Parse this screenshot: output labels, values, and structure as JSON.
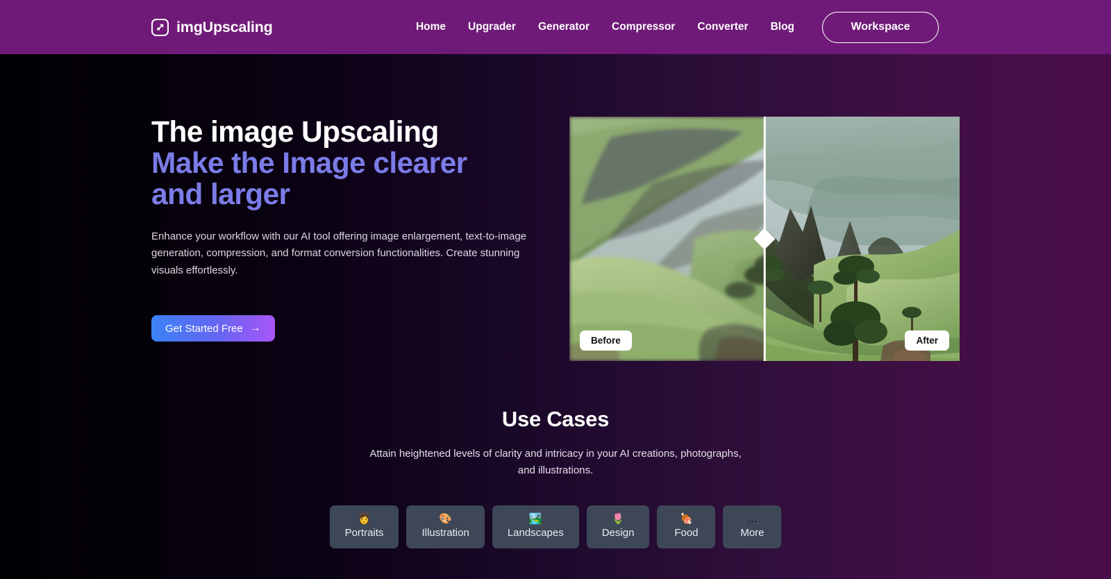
{
  "header": {
    "logo_icon": "expand-arrow-square-icon",
    "brand_name": "imgUpscaling",
    "nav": [
      {
        "label": "Home"
      },
      {
        "label": "Upgrader"
      },
      {
        "label": "Generator"
      },
      {
        "label": "Compressor"
      },
      {
        "label": "Converter"
      },
      {
        "label": "Blog"
      }
    ],
    "workspace_label": "Workspace",
    "background_color": "#6f1a78"
  },
  "hero": {
    "title_line1": "The image Upscaling",
    "title_line2": "Make the Image clearer",
    "title_line3": "and larger",
    "accent_color": "#7b7ce8",
    "paragraph": "Enhance your workflow with our AI tool offering image enlargement, text-to-image generation, compression, and format conversion functionalities. Create stunning visuals effortlessly.",
    "cta_label": "Get Started Free",
    "cta_arrow": "→",
    "cta_gradient_from": "#3b82f6",
    "cta_gradient_to": "#a855f7"
  },
  "comparison": {
    "before_label": "Before",
    "after_label": "After",
    "slider_position_percent": 50,
    "handle_icon": "diamond-slider-handle-icon",
    "subject": "green mountain hillside landscape"
  },
  "usecases": {
    "title": "Use Cases",
    "subtitle": "Attain heightened levels of clarity and intricacy in your AI creations, photographs, and illustrations.",
    "chips": [
      {
        "emoji": "👩",
        "icon": "person-icon",
        "label": "Portraits"
      },
      {
        "emoji": "🎨",
        "icon": "palette-icon",
        "label": "Illustration"
      },
      {
        "emoji": "🏞️",
        "icon": "national-park-icon",
        "label": "Landscapes"
      },
      {
        "emoji": "🌷",
        "icon": "tulip-icon",
        "label": "Design"
      },
      {
        "emoji": "🍖",
        "icon": "meat-on-bone-icon",
        "label": "Food"
      },
      {
        "emoji": "…",
        "icon": "ellipsis-icon",
        "label": "More"
      }
    ],
    "chip_background": "#3d4757"
  },
  "page": {
    "background_from": "#020004",
    "background_to": "#4a0d4b"
  }
}
